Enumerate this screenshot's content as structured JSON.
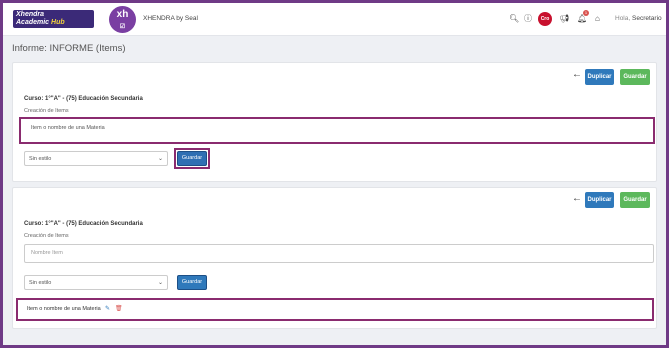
{
  "header": {
    "logo_line1": "Xhendra",
    "logo_line2": "Academic",
    "logo_hub": "Hub",
    "avatar_text": "xh",
    "brand": "XHENDRA by Seal",
    "lang_badge": "Cro",
    "bell_count": "1",
    "user_label": "Hola,",
    "user_role": "Secretario"
  },
  "page": {
    "title": "Informe: INFORME (Items)"
  },
  "card1": {
    "duplicate_label": "Duplicar",
    "save_top_label": "Guardar",
    "course": "Curso: 1°\"A\" - (75) Educación Secundaria",
    "section_label": "Creación de Items",
    "input_value": "Item o nombre de una Materia",
    "select_value": "Sin estilo",
    "save_label": "Guardar"
  },
  "card2": {
    "duplicate_label": "Duplicar",
    "save_top_label": "Guardar",
    "course": "Curso: 1°\"A\" - (75) Educación Secundaria",
    "section_label": "Creación de Items",
    "input_placeholder": "Nombre Item",
    "select_value": "Sin estilo",
    "save_label": "Guardar",
    "item_text": "Item o nombre de una Materia"
  },
  "colors": {
    "primary": "#2f79bb",
    "success": "#5cb85c",
    "highlight": "#8a2b6f",
    "frame": "#6f3a86"
  }
}
